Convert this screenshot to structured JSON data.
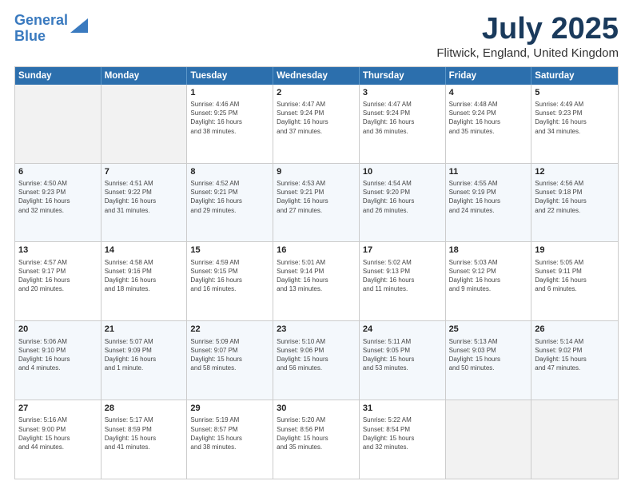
{
  "logo": {
    "line1": "General",
    "line2": "Blue"
  },
  "title": "July 2025",
  "subtitle": "Flitwick, England, United Kingdom",
  "days_of_week": [
    "Sunday",
    "Monday",
    "Tuesday",
    "Wednesday",
    "Thursday",
    "Friday",
    "Saturday"
  ],
  "weeks": [
    [
      {
        "num": "",
        "info": ""
      },
      {
        "num": "",
        "info": ""
      },
      {
        "num": "1",
        "info": "Sunrise: 4:46 AM\nSunset: 9:25 PM\nDaylight: 16 hours\nand 38 minutes."
      },
      {
        "num": "2",
        "info": "Sunrise: 4:47 AM\nSunset: 9:24 PM\nDaylight: 16 hours\nand 37 minutes."
      },
      {
        "num": "3",
        "info": "Sunrise: 4:47 AM\nSunset: 9:24 PM\nDaylight: 16 hours\nand 36 minutes."
      },
      {
        "num": "4",
        "info": "Sunrise: 4:48 AM\nSunset: 9:24 PM\nDaylight: 16 hours\nand 35 minutes."
      },
      {
        "num": "5",
        "info": "Sunrise: 4:49 AM\nSunset: 9:23 PM\nDaylight: 16 hours\nand 34 minutes."
      }
    ],
    [
      {
        "num": "6",
        "info": "Sunrise: 4:50 AM\nSunset: 9:23 PM\nDaylight: 16 hours\nand 32 minutes."
      },
      {
        "num": "7",
        "info": "Sunrise: 4:51 AM\nSunset: 9:22 PM\nDaylight: 16 hours\nand 31 minutes."
      },
      {
        "num": "8",
        "info": "Sunrise: 4:52 AM\nSunset: 9:21 PM\nDaylight: 16 hours\nand 29 minutes."
      },
      {
        "num": "9",
        "info": "Sunrise: 4:53 AM\nSunset: 9:21 PM\nDaylight: 16 hours\nand 27 minutes."
      },
      {
        "num": "10",
        "info": "Sunrise: 4:54 AM\nSunset: 9:20 PM\nDaylight: 16 hours\nand 26 minutes."
      },
      {
        "num": "11",
        "info": "Sunrise: 4:55 AM\nSunset: 9:19 PM\nDaylight: 16 hours\nand 24 minutes."
      },
      {
        "num": "12",
        "info": "Sunrise: 4:56 AM\nSunset: 9:18 PM\nDaylight: 16 hours\nand 22 minutes."
      }
    ],
    [
      {
        "num": "13",
        "info": "Sunrise: 4:57 AM\nSunset: 9:17 PM\nDaylight: 16 hours\nand 20 minutes."
      },
      {
        "num": "14",
        "info": "Sunrise: 4:58 AM\nSunset: 9:16 PM\nDaylight: 16 hours\nand 18 minutes."
      },
      {
        "num": "15",
        "info": "Sunrise: 4:59 AM\nSunset: 9:15 PM\nDaylight: 16 hours\nand 16 minutes."
      },
      {
        "num": "16",
        "info": "Sunrise: 5:01 AM\nSunset: 9:14 PM\nDaylight: 16 hours\nand 13 minutes."
      },
      {
        "num": "17",
        "info": "Sunrise: 5:02 AM\nSunset: 9:13 PM\nDaylight: 16 hours\nand 11 minutes."
      },
      {
        "num": "18",
        "info": "Sunrise: 5:03 AM\nSunset: 9:12 PM\nDaylight: 16 hours\nand 9 minutes."
      },
      {
        "num": "19",
        "info": "Sunrise: 5:05 AM\nSunset: 9:11 PM\nDaylight: 16 hours\nand 6 minutes."
      }
    ],
    [
      {
        "num": "20",
        "info": "Sunrise: 5:06 AM\nSunset: 9:10 PM\nDaylight: 16 hours\nand 4 minutes."
      },
      {
        "num": "21",
        "info": "Sunrise: 5:07 AM\nSunset: 9:09 PM\nDaylight: 16 hours\nand 1 minute."
      },
      {
        "num": "22",
        "info": "Sunrise: 5:09 AM\nSunset: 9:07 PM\nDaylight: 15 hours\nand 58 minutes."
      },
      {
        "num": "23",
        "info": "Sunrise: 5:10 AM\nSunset: 9:06 PM\nDaylight: 15 hours\nand 56 minutes."
      },
      {
        "num": "24",
        "info": "Sunrise: 5:11 AM\nSunset: 9:05 PM\nDaylight: 15 hours\nand 53 minutes."
      },
      {
        "num": "25",
        "info": "Sunrise: 5:13 AM\nSunset: 9:03 PM\nDaylight: 15 hours\nand 50 minutes."
      },
      {
        "num": "26",
        "info": "Sunrise: 5:14 AM\nSunset: 9:02 PM\nDaylight: 15 hours\nand 47 minutes."
      }
    ],
    [
      {
        "num": "27",
        "info": "Sunrise: 5:16 AM\nSunset: 9:00 PM\nDaylight: 15 hours\nand 44 minutes."
      },
      {
        "num": "28",
        "info": "Sunrise: 5:17 AM\nSunset: 8:59 PM\nDaylight: 15 hours\nand 41 minutes."
      },
      {
        "num": "29",
        "info": "Sunrise: 5:19 AM\nSunset: 8:57 PM\nDaylight: 15 hours\nand 38 minutes."
      },
      {
        "num": "30",
        "info": "Sunrise: 5:20 AM\nSunset: 8:56 PM\nDaylight: 15 hours\nand 35 minutes."
      },
      {
        "num": "31",
        "info": "Sunrise: 5:22 AM\nSunset: 8:54 PM\nDaylight: 15 hours\nand 32 minutes."
      },
      {
        "num": "",
        "info": ""
      },
      {
        "num": "",
        "info": ""
      }
    ]
  ]
}
